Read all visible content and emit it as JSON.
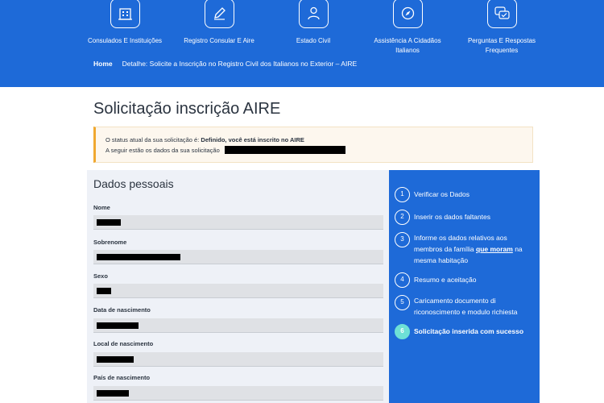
{
  "nav": [
    {
      "label": "Consulados E Instituições",
      "icon": "building-icon"
    },
    {
      "label": "Registro Consular E Aire",
      "icon": "pencil-icon"
    },
    {
      "label": "Estado Civil",
      "icon": "user-icon"
    },
    {
      "label": "Assistência A Cidadãos Italianos",
      "icon": "compass-icon"
    },
    {
      "label": "Perguntas E Respostas Frequentes",
      "icon": "chat-check-icon"
    }
  ],
  "breadcrumb": {
    "home": "Home",
    "current": "Detalhe: Solicite a Inscrição no Registro Civil dos Italianos no Exterior – AIRE"
  },
  "page_title": "Solicitação inscrição AIRE",
  "alert": {
    "status_prefix": "O status atual da sua solicitação é: ",
    "status_value": "Definido, você está inscrito no AIRE",
    "data_line": "A seguir estão os dados da sua solicitação"
  },
  "form": {
    "section_title": "Dados pessoais",
    "fields": [
      {
        "label": "Nome"
      },
      {
        "label": "Sobrenome"
      },
      {
        "label": "Sexo"
      },
      {
        "label": "Data de nascimento"
      },
      {
        "label": "Local de nascimento"
      },
      {
        "label": "País de nascimento"
      }
    ]
  },
  "steps": [
    {
      "num": "1",
      "text": "Verificar os Dados"
    },
    {
      "num": "2",
      "text": "Inserir os dados faltantes"
    },
    {
      "num": "3",
      "text_before": "Informe os dados relativos aos membros da família ",
      "link": "que moram",
      "text_after": " na mesma habitação"
    },
    {
      "num": "4",
      "text": "Resumo e aceitação"
    },
    {
      "num": "5",
      "text": "Caricamento documento di riconoscimento e modulo richiesta"
    },
    {
      "num": "6",
      "text": "Solicitação inserida com sucesso"
    }
  ],
  "colors": {
    "header": "#1e6ad8",
    "active_step": "#6ee0d6",
    "alert_border": "#f0a830"
  }
}
